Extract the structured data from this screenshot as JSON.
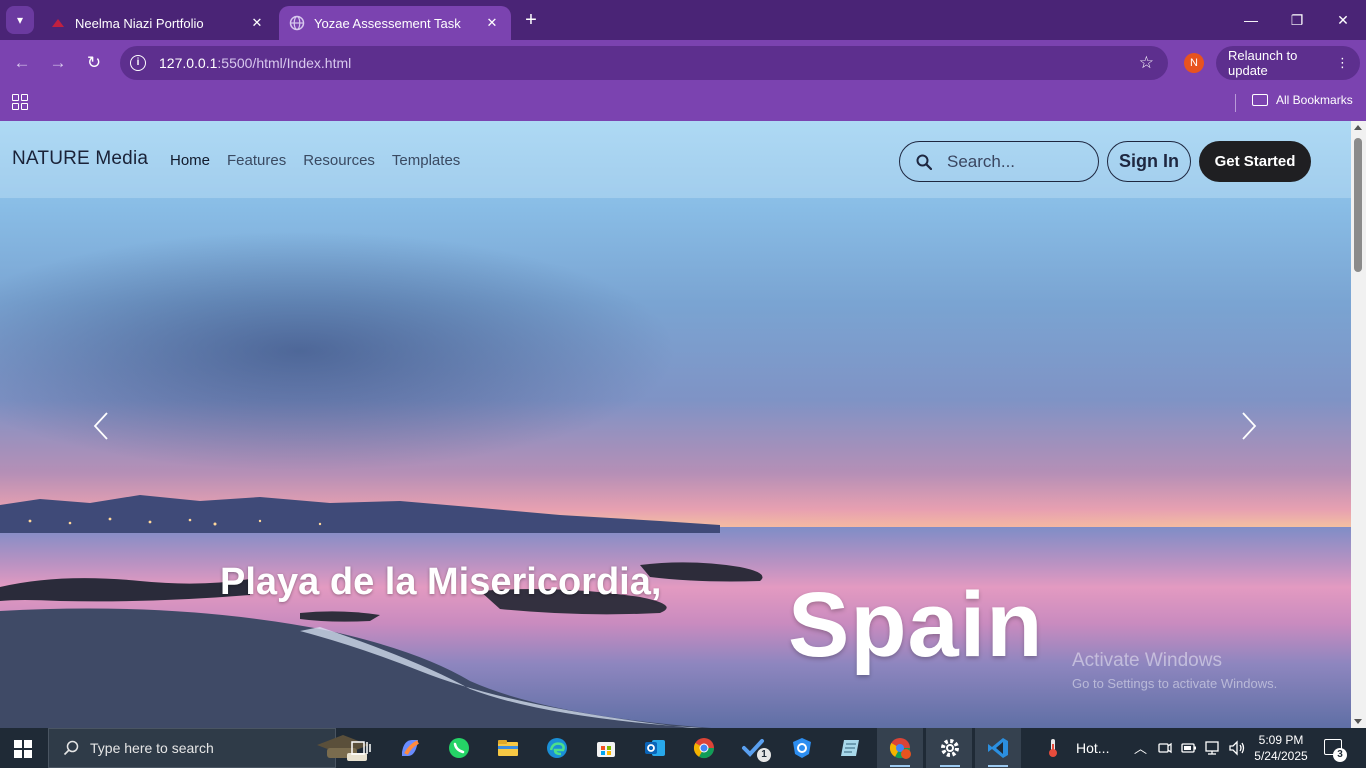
{
  "browser": {
    "tabs": [
      {
        "title": "Neelma Niazi Portfolio",
        "active": false
      },
      {
        "title": "Yozae Assessement Task",
        "active": true
      }
    ],
    "url_host": "127.0.0.1",
    "url_path": ":5500/html/Index.html",
    "profile_initial": "N",
    "relaunch_label": "Relaunch to update",
    "relaunch_more": "⋮",
    "all_bookmarks": "All Bookmarks",
    "colors": {
      "tabstrip": "#4a2476",
      "toolbar": "#7b43b0",
      "profile": "#e8531f"
    }
  },
  "site": {
    "brand": "NATURE Media",
    "nav": [
      "Home",
      "Features",
      "Resources",
      "Templates"
    ],
    "search_placeholder": "Search...",
    "signin_label": "Sign In",
    "get_started_label": "Get Started",
    "hero": {
      "caption": "Playa de la Misericordia,",
      "caption_large": "Spain"
    }
  },
  "watermark": {
    "line1": "Activate Windows",
    "line2": "Go to Settings to activate Windows."
  },
  "taskbar": {
    "search_placeholder": "Type here to search",
    "tray_weather": "Hot...",
    "time": "5:09 PM",
    "date": "5/24/2025",
    "notification_count": "3",
    "todo_badge": "1",
    "icons": [
      "windows-start-icon",
      "task-view-icon",
      "copilot-icon",
      "whatsapp-icon",
      "file-explorer-icon",
      "edge-icon",
      "store-icon",
      "outlook-icon",
      "chrome-icon",
      "todo-icon",
      "vpn-icon",
      "notes-icon",
      "chrome-profile-icon",
      "settings-icon",
      "vscode-icon"
    ]
  }
}
